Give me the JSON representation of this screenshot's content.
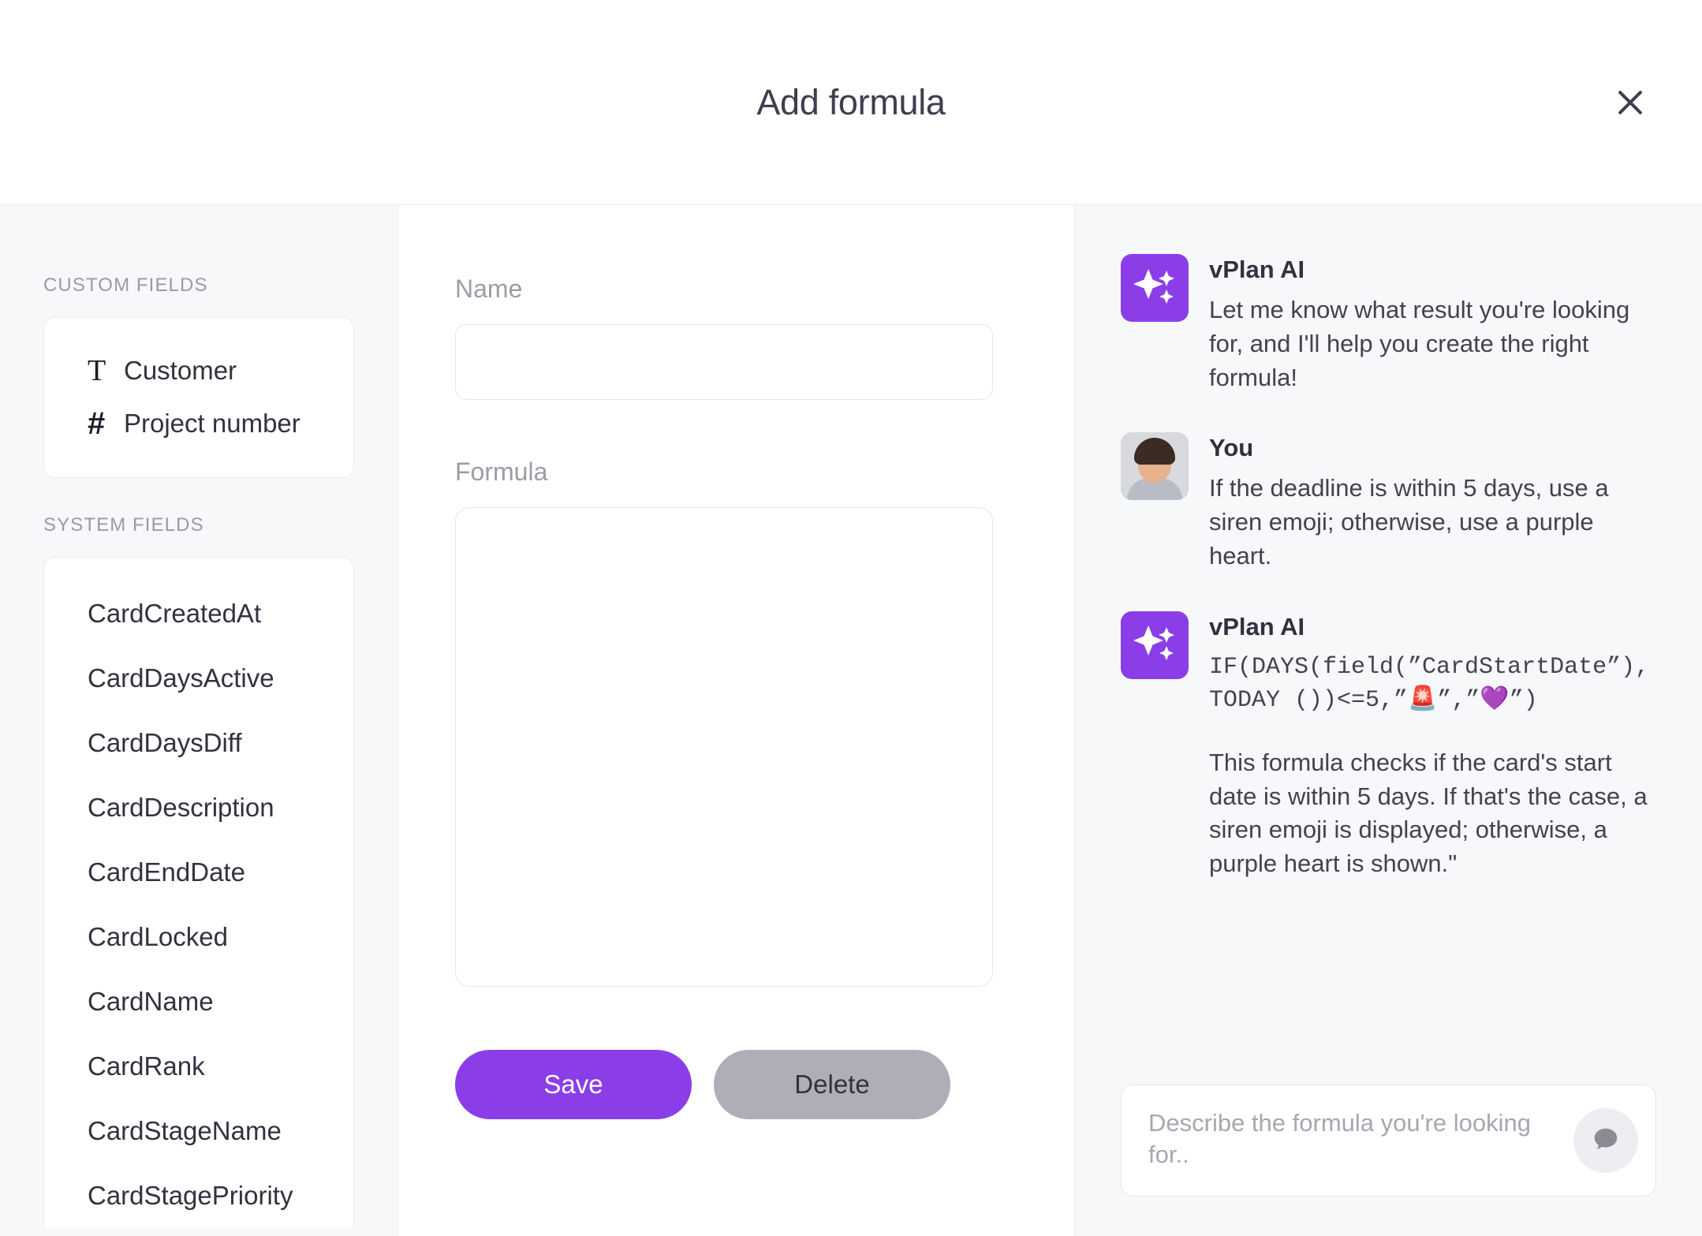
{
  "header": {
    "title": "Add formula",
    "close_label": "×"
  },
  "sidebar": {
    "custom_fields_label": "CUSTOM FIELDS",
    "system_fields_label": "SYSTEM FIELDS",
    "custom_fields": [
      {
        "icon": "text-type-icon",
        "glyph": "T",
        "label": "Customer"
      },
      {
        "icon": "number-type-icon",
        "glyph": "#",
        "label": "Project number"
      }
    ],
    "system_fields": [
      {
        "label": "CardCreatedAt"
      },
      {
        "label": "CardDaysActive"
      },
      {
        "label": "CardDaysDiff"
      },
      {
        "label": "CardDescription"
      },
      {
        "label": "CardEndDate"
      },
      {
        "label": "CardLocked"
      },
      {
        "label": "CardName"
      },
      {
        "label": "CardRank"
      },
      {
        "label": "CardStageName"
      },
      {
        "label": "CardStagePriority"
      }
    ]
  },
  "form": {
    "name_label": "Name",
    "name_value": "",
    "name_placeholder": "",
    "formula_label": "Formula",
    "formula_value": "",
    "formula_placeholder": "",
    "save_label": "Save",
    "delete_label": "Delete"
  },
  "ai_panel": {
    "messages": [
      {
        "author": "vPlan AI",
        "avatar": "sparkle-icon",
        "text": "Let me know what result you're looking for, and I'll help you create the right formula!"
      },
      {
        "author": "You",
        "avatar": "user-photo",
        "text": "If the deadline is within 5 days, use a siren emoji; otherwise, use a purple heart."
      },
      {
        "author": "vPlan AI",
        "avatar": "sparkle-icon",
        "code": "IF(DAYS(field(”CardStartDate”), TODAY ())<=5,”🚨”,”💜”)",
        "explanation": "This formula checks if the card's start date is within 5 days. If that's the case, a siren emoji is displayed; otherwise, a purple heart is shown.\""
      }
    ],
    "input_placeholder": "Describe the formula you're looking for..",
    "input_value": "",
    "send_icon": "chat-bubble-icon"
  },
  "colors": {
    "accent_purple": "#8B3EE8",
    "delete_gray": "#AEAEB6",
    "panel_bg": "#F7F8FA",
    "text_dark": "#32323F"
  }
}
